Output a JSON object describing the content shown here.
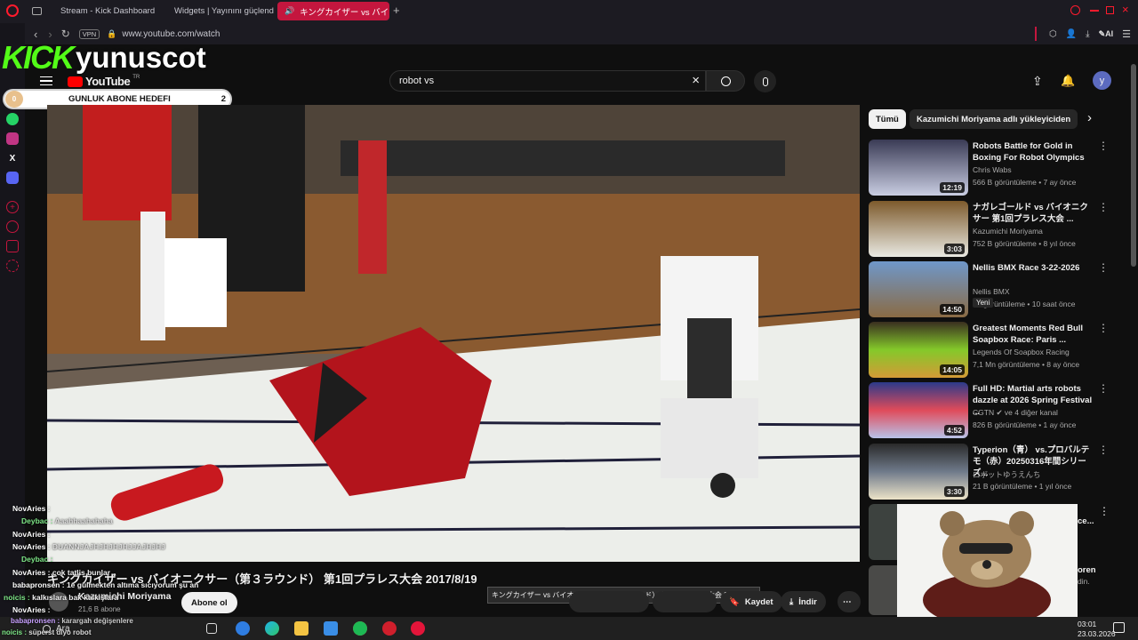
{
  "browser": {
    "tabs": [
      {
        "label": "Stream - Kick Dashboard",
        "icon": "kick-icon"
      },
      {
        "label": "Widgets | Yayınını güçlend",
        "icon": "widgets-icon"
      },
      {
        "label": "キングカイザー vs バイオニクサー",
        "icon": "speaker-icon"
      }
    ],
    "vpn": "VPN",
    "url": "www.youtube.com/watch",
    "ai_label": "AI"
  },
  "overlay": {
    "brand_kick": "KICK",
    "brand_user": "yunuscot",
    "goal_label": "GUNLUK ABONE HEDEFI",
    "goal_current": "0",
    "goal_target": "2"
  },
  "youtube": {
    "logo": "YouTube",
    "logo_sup": "TR",
    "search_value": "robot vs",
    "avatar_letter": "y",
    "chips": [
      "Tümü",
      "Kazumichi Moriyama adlı yükleyiciden"
    ],
    "video_title": "キングカイザー vs バイオニクサー（第３ラウンド） 第1回プラレス大会 2017/8/19",
    "tooltip": "キングカイザー vs バイオニクサー（第３ラウンド） 第1回プラレス大会 2017/8/19",
    "channel_name": "Kazumichi Moriyama",
    "subs": "21,6 B abone",
    "subscribe": "Abone ol",
    "save": "Kaydet",
    "download": "İndir",
    "more": "⋯"
  },
  "recommendations": [
    {
      "title": "Robots Battle for Gold in Boxing For Robot Olympics",
      "channel": "Chris Wabs",
      "meta": "566 B görüntüleme • 7 ay önce",
      "duration": "12:19",
      "badge": ""
    },
    {
      "title": "ナガレゴールド vs バイオニクサー 第1回プラレス大会 ...",
      "channel": "Kazumichi Moriyama",
      "meta": "752 B görüntüleme • 8 yıl önce",
      "duration": "3:03",
      "badge": ""
    },
    {
      "title": "Nellis BMX Race 3-22-2026",
      "channel": "Nellis BMX",
      "meta": "43 görüntüleme • 10 saat önce",
      "duration": "14:50",
      "badge": "Yeni"
    },
    {
      "title": "Greatest Moments Red Bull Soapbox Race: Paris ...",
      "channel": "Legends Of Soapbox Racing",
      "meta": "7,1 Mn görüntüleme • 8 ay önce",
      "duration": "14:05",
      "badge": ""
    },
    {
      "title": "Full HD: Martial arts robots dazzle at 2026 Spring Festival ...",
      "channel": "CGTN ✔ ve 4 diğer kanal",
      "meta": "826 B görüntüleme • 1 ay önce",
      "duration": "4:52",
      "badge": ""
    },
    {
      "title": "Typerion（青） vs.プロバルテモ（赤）20250316年間シリーズ...",
      "channel": "ロボットゆうえんち",
      "meta": "21 B görüntüleme • 1 yıl önce",
      "duration": "3:30",
      "badge": ""
    }
  ],
  "chat": [
    {
      "user": "NovAries :",
      "msg": "",
      "color": "#ffffff"
    },
    {
      "user": "Deybac :",
      "msg": "Aaahhaahahaha",
      "color": "#7ee787"
    },
    {
      "user": "NovAries :",
      "msg": "",
      "color": "#ffffff"
    },
    {
      "user": "NovAries :",
      "msg": "DUANNJAJHJHJHJHJJAJHJHJ",
      "color": "#ffffff"
    },
    {
      "user": "Deybac :",
      "msg": "",
      "color": "#7ee787"
    },
    {
      "user": "NovAries :",
      "msg": "cok tatlis bunlar",
      "color": "#ffffff"
    },
    {
      "user": "babapronsen :",
      "msg": "1e gulmekten altıma sıcıyorum şu an",
      "color": "#ffffff"
    },
    {
      "user": "noicis :",
      "msg": "kalkıslara bak kalkışlara",
      "color": "#7ee787"
    },
    {
      "user": "NovAries :",
      "msg": "",
      "color": "#ffffff"
    },
    {
      "user": "babapronsen :",
      "msg": "karargah değişenlere",
      "color": "#c8a0ff"
    },
    {
      "user": "noicis :",
      "msg": "süperst diyo robot",
      "color": "#7ee787"
    }
  ],
  "taskbar": {
    "search": "Ara",
    "time": "03:01",
    "date": "23.03.2026"
  },
  "partial": {
    "r7": "ce...",
    "r8a": "oren",
    "r8b": "din."
  }
}
